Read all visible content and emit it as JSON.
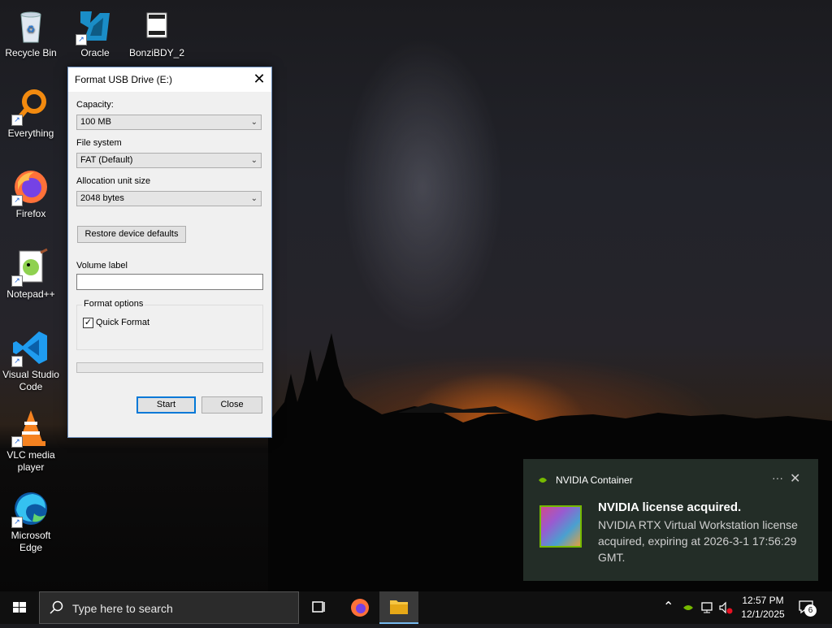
{
  "desktop": {
    "icons": [
      {
        "label": "Recycle Bin",
        "icon": "recycle-bin-icon"
      },
      {
        "label": "Oracle VirtualBox",
        "icon": "virtualbox-icon"
      },
      {
        "label": "BonziBDY_2",
        "icon": "file-icon"
      },
      {
        "label": "Everything",
        "icon": "everything-search-icon"
      },
      {
        "label": "Firefox",
        "icon": "firefox-icon"
      },
      {
        "label": "Notepad++",
        "icon": "notepadpp-icon"
      },
      {
        "label": "Visual Studio Code",
        "icon": "vscode-icon"
      },
      {
        "label": "VLC media player",
        "icon": "vlc-icon"
      },
      {
        "label": "Microsoft Edge",
        "icon": "edge-icon"
      }
    ]
  },
  "dialog": {
    "title": "Format USB Drive (E:)",
    "capacity_label": "Capacity:",
    "capacity_value": "100 MB",
    "filesystem_label": "File system",
    "filesystem_value": "FAT (Default)",
    "alloc_label": "Allocation unit size",
    "alloc_value": "2048 bytes",
    "restore_button": "Restore device defaults",
    "volume_label": "Volume label",
    "volume_value": "",
    "format_options_label": "Format options",
    "quick_format_label": "Quick Format",
    "quick_format_checked": true,
    "progress": 0,
    "start_button": "Start",
    "close_button": "Close"
  },
  "toast": {
    "app_name": "NVIDIA Container",
    "title": "NVIDIA license acquired.",
    "body": "NVIDIA RTX Virtual Workstation license acquired, expiring at 2026-3-1 17:56:29 GMT.",
    "accent": "#76b900"
  },
  "taskbar": {
    "search_placeholder": "Type here to search",
    "time": "12:57 PM",
    "date": "12/1/2025",
    "notification_count": "6"
  }
}
